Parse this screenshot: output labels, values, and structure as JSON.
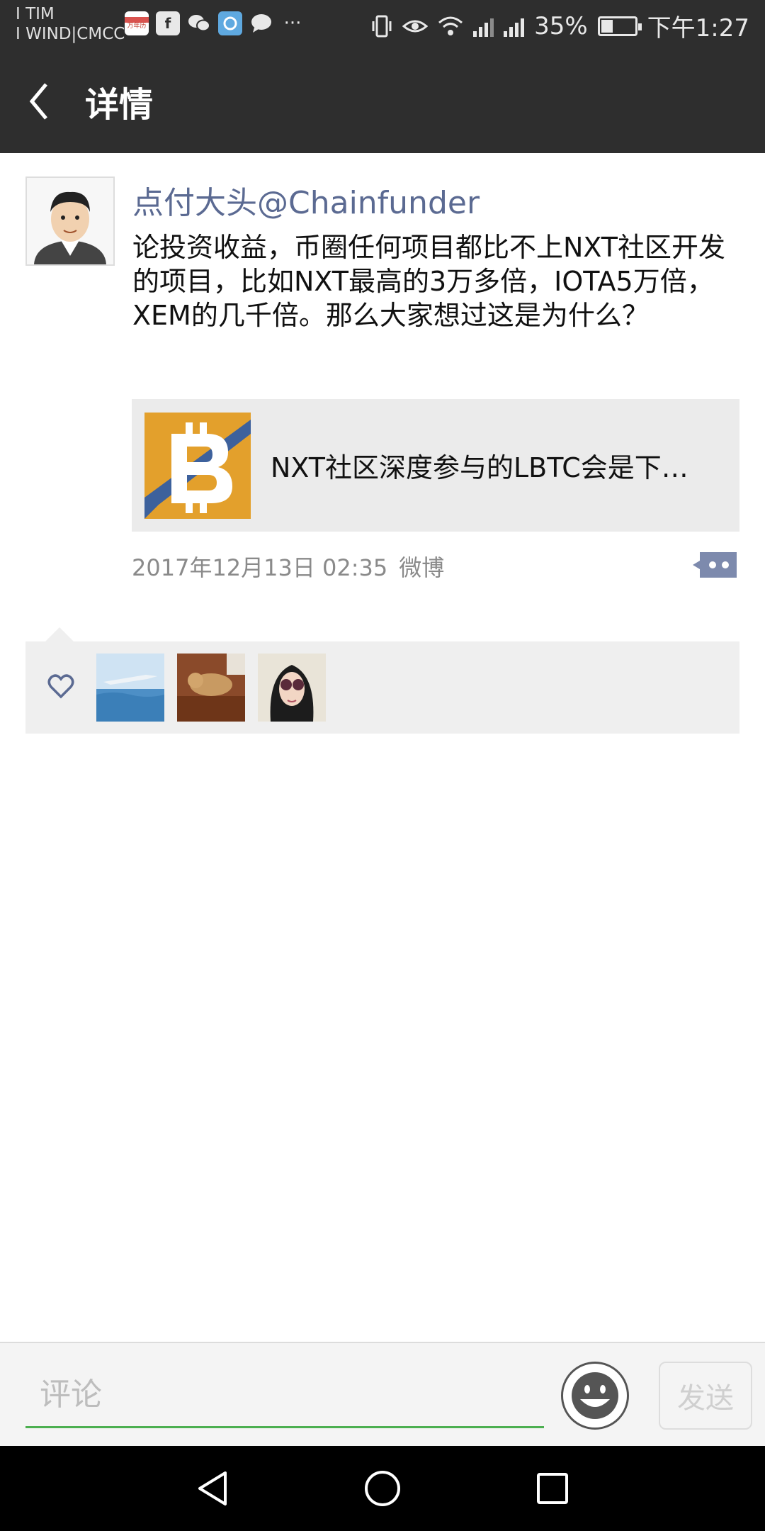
{
  "status_bar": {
    "carrier_line1": "I TIM",
    "carrier_line2": "I WIND|CMCC",
    "battery_percent": "35%",
    "battery_level": 0.35,
    "time": "下午1:27",
    "calendar_icon_text": "万年历"
  },
  "header": {
    "title": "详情"
  },
  "post": {
    "author": "点付大头@Chainfunder",
    "text": "论投资收益，币圈任何项目都比不上NXT社区开发的项目，比如NXT最高的3万多倍，IOTA5万倍，XEM的几千倍。那么大家想过这是为什么？",
    "share": {
      "title": "NXT社区深度参与的LBTC会是下…"
    },
    "date": "2017年12月13日 02:35",
    "source": "微博"
  },
  "likes": {
    "count": 3
  },
  "comment_bar": {
    "placeholder": "评论",
    "send_label": "发送"
  },
  "colors": {
    "bar": "#2e2e2e",
    "link": "#5b6a92",
    "accent_green": "#4caf50"
  }
}
